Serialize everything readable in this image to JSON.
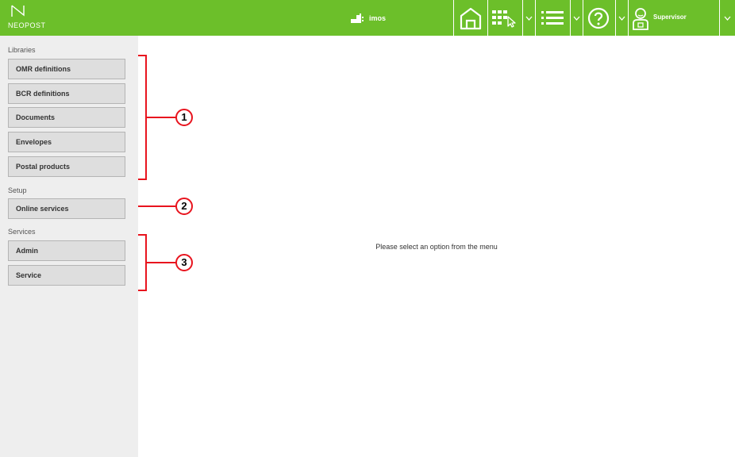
{
  "header": {
    "brand": "NEOPOST",
    "machine_name": "imos",
    "user_name": "Supervisor",
    "accent_color": "#6cbf2a",
    "icons": [
      "neopost-logo-icon",
      "machine-icon",
      "home-icon",
      "job-select-icon",
      "list-menu-icon",
      "help-icon",
      "user-icon",
      "chevron-down-icon"
    ]
  },
  "sidebar": {
    "sections": [
      {
        "title": "Libraries",
        "items": [
          "OMR definitions",
          "BCR definitions",
          "Documents",
          "Envelopes",
          "Postal products"
        ]
      },
      {
        "title": "Setup",
        "items": [
          "Online services"
        ]
      },
      {
        "title": "Services",
        "items": [
          "Admin",
          "Service"
        ]
      }
    ]
  },
  "main": {
    "placeholder": "Please select an option from the menu"
  },
  "callouts": [
    "1",
    "2",
    "3"
  ],
  "callout_color": "#e8141e"
}
